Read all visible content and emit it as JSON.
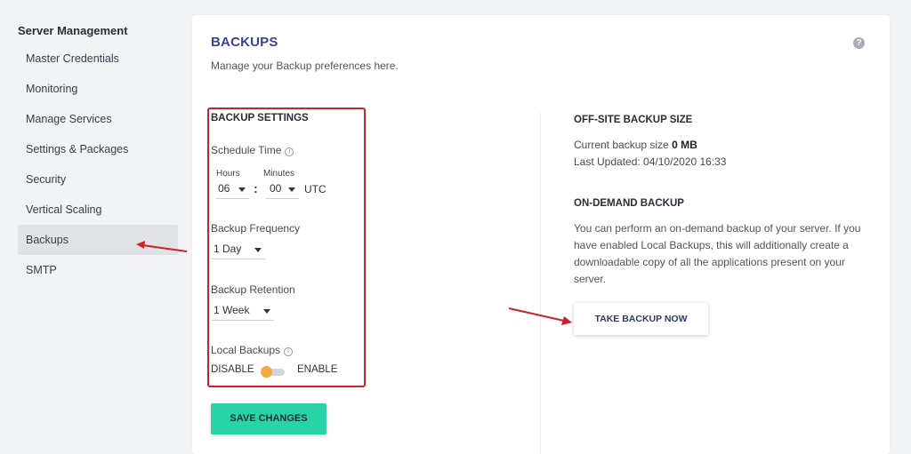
{
  "sidebar": {
    "title": "Server Management",
    "items": [
      {
        "label": "Master Credentials"
      },
      {
        "label": "Monitoring"
      },
      {
        "label": "Manage Services"
      },
      {
        "label": "Settings & Packages"
      },
      {
        "label": "Security"
      },
      {
        "label": "Vertical Scaling"
      },
      {
        "label": "Backups",
        "active": true
      },
      {
        "label": "SMTP"
      }
    ]
  },
  "page": {
    "title": "BACKUPS",
    "subtitle": "Manage your Backup preferences here.",
    "help_icon": "help-circle-icon"
  },
  "settings": {
    "heading": "BACKUP SETTINGS",
    "schedule_time_label": "Schedule Time",
    "hours_label": "Hours",
    "minutes_label": "Minutes",
    "hours_value": "06",
    "minutes_value": "00",
    "separator": ":",
    "timezone": "UTC",
    "frequency_label": "Backup Frequency",
    "frequency_value": "1 Day",
    "retention_label": "Backup Retention",
    "retention_value": "1 Week",
    "local_backups_label": "Local Backups",
    "toggle_off_label": "DISABLE",
    "toggle_on_label": "ENABLE",
    "local_backups_enabled": false,
    "save_label": "SAVE CHANGES"
  },
  "offsite": {
    "heading": "OFF-SITE BACKUP SIZE",
    "size_prefix": "Current backup size",
    "size_value": "0 MB",
    "last_updated": "Last Updated: 04/10/2020 16:33"
  },
  "on_demand": {
    "heading": "ON-DEMAND BACKUP",
    "description": "You can perform an on-demand backup of your server. If you have enabled Local Backups, this will additionally create a downloadable copy of all the applications present on your server.",
    "button_label": "TAKE BACKUP NOW"
  },
  "colors": {
    "title": "#3a4494",
    "save_button": "#2ad3a6",
    "toggle_knob": "#f5a941",
    "highlight": "#d0212a"
  }
}
